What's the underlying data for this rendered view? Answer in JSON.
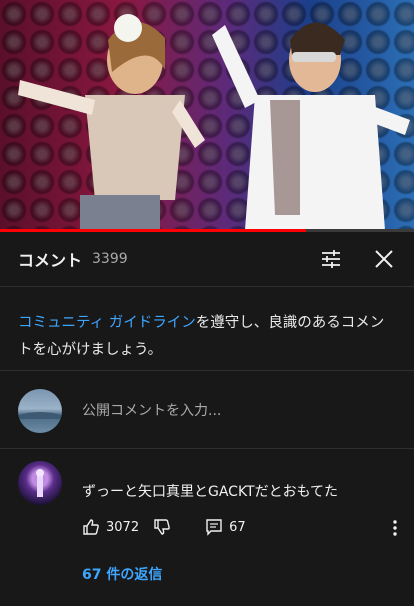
{
  "video": {
    "progress_fraction": 0.74
  },
  "comments_panel": {
    "title": "コメント",
    "count": "3399"
  },
  "guidelines": {
    "link_text": "コミュニティ ガイドライン",
    "rest_text": "を遵守し、良識のあるコメントを心がけましょう。"
  },
  "comment_input": {
    "placeholder": "公開コメントを入力..."
  },
  "comments": [
    {
      "text": "ずっーと矢口真里とGACKTだとおもてた",
      "likes": "3072",
      "reply_count": "67",
      "replies_link": "67 件の返信"
    }
  ],
  "colors": {
    "background": "#181818",
    "link": "#3ea6ff",
    "progress": "#ff0000"
  },
  "icons": [
    "filter-icon",
    "close-icon",
    "thumbs-up-icon",
    "thumbs-down-icon",
    "reply-icon",
    "more-vert-icon"
  ]
}
